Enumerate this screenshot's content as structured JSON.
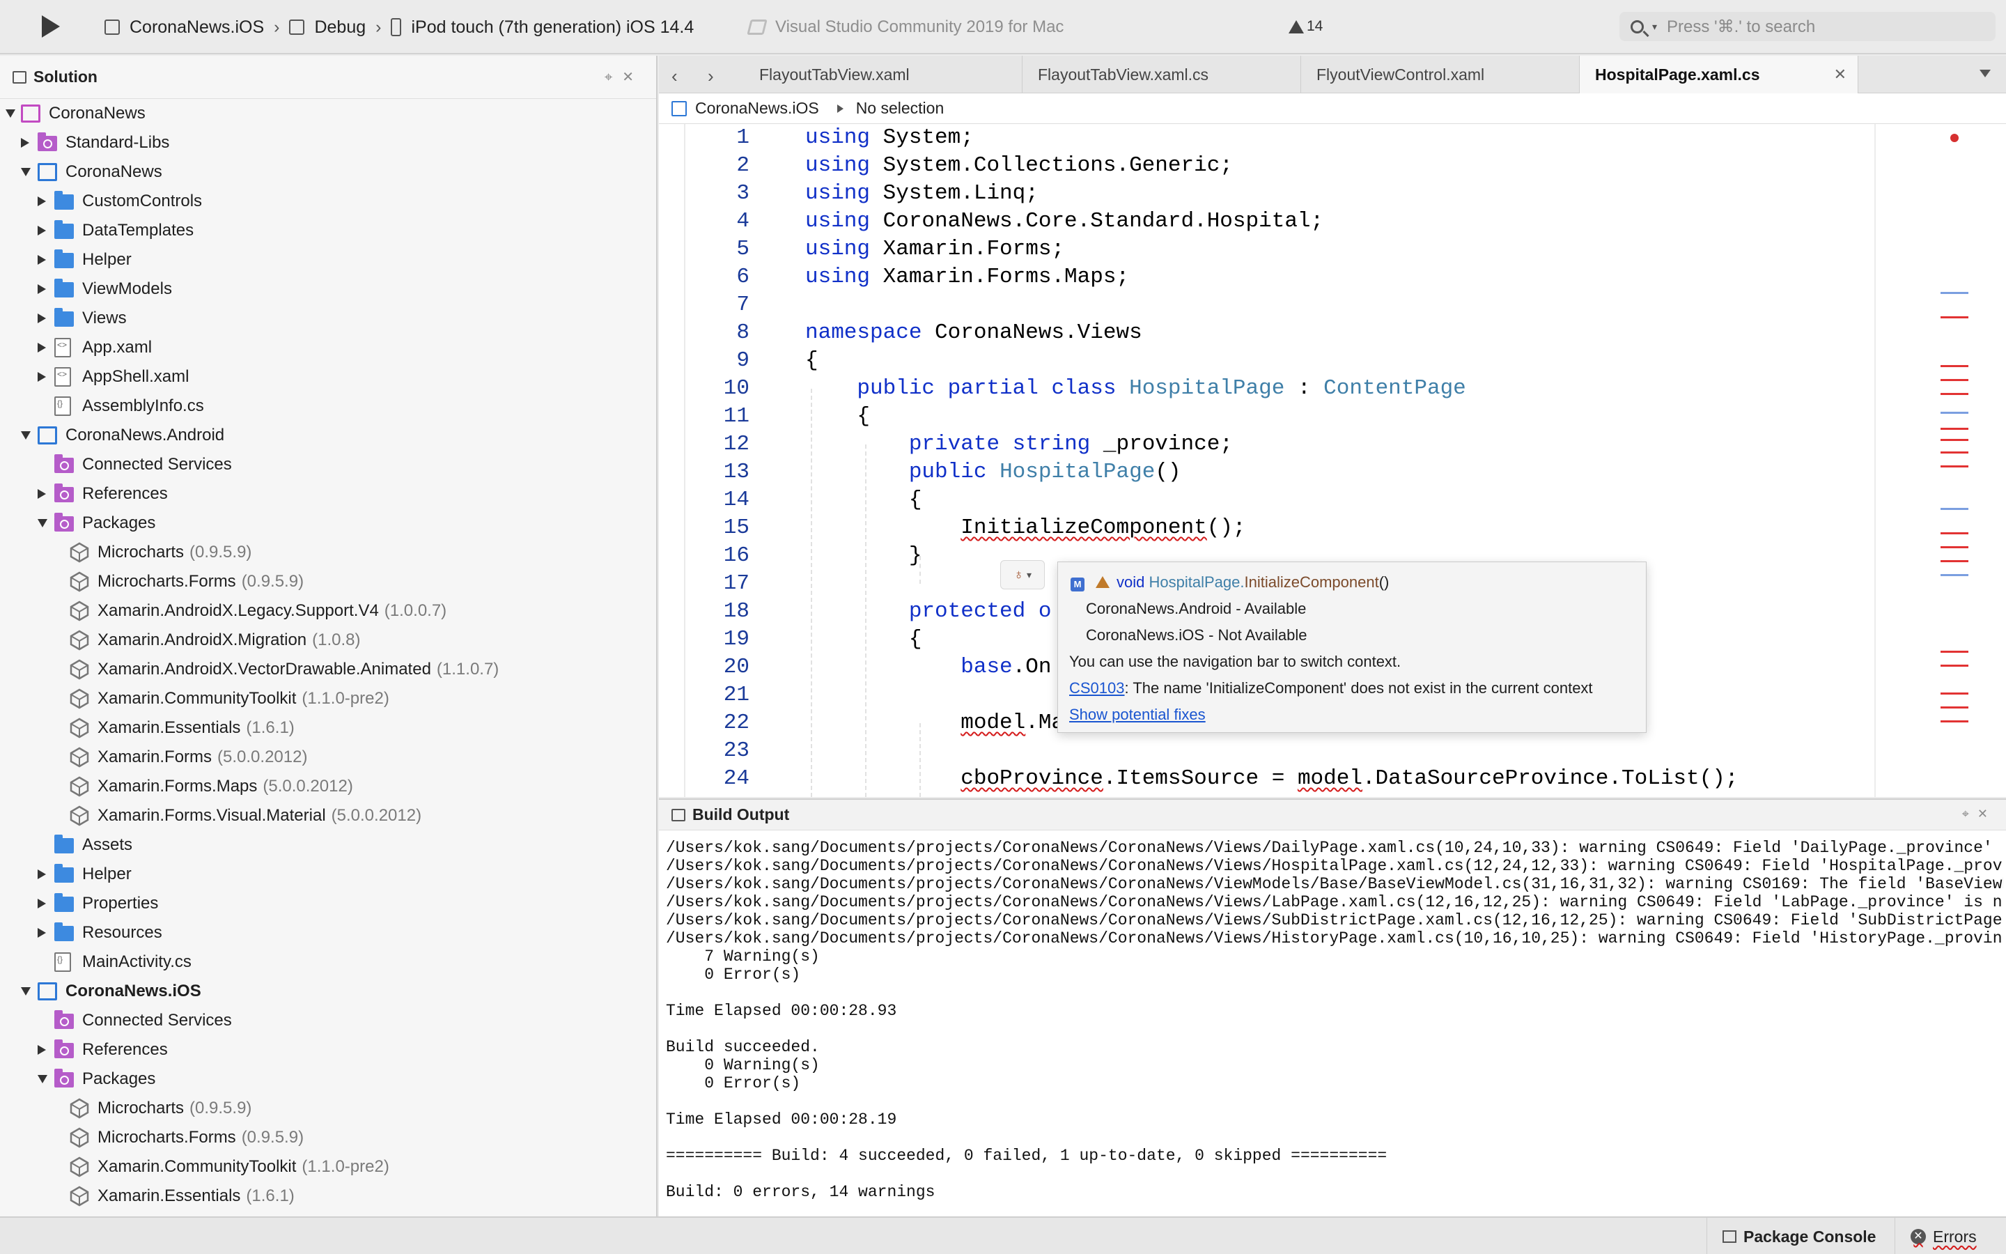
{
  "toolbar": {
    "scheme": "CoronaNews.iOS",
    "config": "Debug",
    "device": "iPod touch (7th generation) iOS 14.4",
    "app_title": "Visual Studio Community 2019 for Mac",
    "warning_count": "14",
    "search_placeholder": "Press '⌘.' to search"
  },
  "solution_pad": {
    "title": "Solution",
    "items": [
      {
        "label": "CoronaNews",
        "ver": "",
        "icon": "solution-icon",
        "depth": 0,
        "arrow": "down",
        "bold": false
      },
      {
        "label": "Standard-Libs",
        "ver": "",
        "icon": "folder-purple-icon",
        "depth": 1,
        "arrow": "right",
        "bold": false
      },
      {
        "label": "CoronaNews",
        "ver": "",
        "icon": "project-icon",
        "depth": 1,
        "arrow": "down",
        "bold": false
      },
      {
        "label": "CustomControls",
        "ver": "",
        "icon": "folder-icon",
        "depth": 2,
        "arrow": "right",
        "bold": false
      },
      {
        "label": "DataTemplates",
        "ver": "",
        "icon": "folder-icon",
        "depth": 2,
        "arrow": "right",
        "bold": false
      },
      {
        "label": "Helper",
        "ver": "",
        "icon": "folder-icon",
        "depth": 2,
        "arrow": "right",
        "bold": false
      },
      {
        "label": "ViewModels",
        "ver": "",
        "icon": "folder-icon",
        "depth": 2,
        "arrow": "right",
        "bold": false
      },
      {
        "label": "Views",
        "ver": "",
        "icon": "folder-icon",
        "depth": 2,
        "arrow": "right",
        "bold": false
      },
      {
        "label": "App.xaml",
        "ver": "",
        "icon": "xaml-file-icon",
        "depth": 2,
        "arrow": "right",
        "bold": false
      },
      {
        "label": "AppShell.xaml",
        "ver": "",
        "icon": "xaml-file-icon",
        "depth": 2,
        "arrow": "right",
        "bold": false
      },
      {
        "label": "AssemblyInfo.cs",
        "ver": "",
        "icon": "cs-file-icon",
        "depth": 2,
        "arrow": "",
        "bold": false
      },
      {
        "label": "CoronaNews.Android",
        "ver": "",
        "icon": "project-icon",
        "depth": 1,
        "arrow": "down",
        "bold": false
      },
      {
        "label": "Connected Services",
        "ver": "",
        "icon": "connected-services-icon",
        "depth": 2,
        "arrow": "",
        "bold": false
      },
      {
        "label": "References",
        "ver": "",
        "icon": "references-icon",
        "depth": 2,
        "arrow": "right",
        "bold": false
      },
      {
        "label": "Packages",
        "ver": "",
        "icon": "packages-icon",
        "depth": 2,
        "arrow": "down",
        "bold": false
      },
      {
        "label": "Microcharts",
        "ver": "(0.9.5.9)",
        "icon": "package-icon",
        "depth": 3,
        "arrow": "",
        "bold": false
      },
      {
        "label": "Microcharts.Forms",
        "ver": "(0.9.5.9)",
        "icon": "package-icon",
        "depth": 3,
        "arrow": "",
        "bold": false
      },
      {
        "label": "Xamarin.AndroidX.Legacy.Support.V4",
        "ver": "(1.0.0.7)",
        "icon": "package-icon",
        "depth": 3,
        "arrow": "",
        "bold": false
      },
      {
        "label": "Xamarin.AndroidX.Migration",
        "ver": "(1.0.8)",
        "icon": "package-icon",
        "depth": 3,
        "arrow": "",
        "bold": false
      },
      {
        "label": "Xamarin.AndroidX.VectorDrawable.Animated",
        "ver": "(1.1.0.7)",
        "icon": "package-icon",
        "depth": 3,
        "arrow": "",
        "bold": false
      },
      {
        "label": "Xamarin.CommunityToolkit",
        "ver": "(1.1.0-pre2)",
        "icon": "package-icon",
        "depth": 3,
        "arrow": "",
        "bold": false
      },
      {
        "label": "Xamarin.Essentials",
        "ver": "(1.6.1)",
        "icon": "package-icon",
        "depth": 3,
        "arrow": "",
        "bold": false
      },
      {
        "label": "Xamarin.Forms",
        "ver": "(5.0.0.2012)",
        "icon": "package-icon",
        "depth": 3,
        "arrow": "",
        "bold": false
      },
      {
        "label": "Xamarin.Forms.Maps",
        "ver": "(5.0.0.2012)",
        "icon": "package-icon",
        "depth": 3,
        "arrow": "",
        "bold": false
      },
      {
        "label": "Xamarin.Forms.Visual.Material",
        "ver": "(5.0.0.2012)",
        "icon": "package-icon",
        "depth": 3,
        "arrow": "",
        "bold": false
      },
      {
        "label": "Assets",
        "ver": "",
        "icon": "folder-icon",
        "depth": 2,
        "arrow": "",
        "bold": false
      },
      {
        "label": "Helper",
        "ver": "",
        "icon": "folder-icon",
        "depth": 2,
        "arrow": "right",
        "bold": false
      },
      {
        "label": "Properties",
        "ver": "",
        "icon": "folder-icon",
        "depth": 2,
        "arrow": "right",
        "bold": false
      },
      {
        "label": "Resources",
        "ver": "",
        "icon": "folder-icon",
        "depth": 2,
        "arrow": "right",
        "bold": false
      },
      {
        "label": "MainActivity.cs",
        "ver": "",
        "icon": "cs-file-icon",
        "depth": 2,
        "arrow": "",
        "bold": false
      },
      {
        "label": "CoronaNews.iOS",
        "ver": "",
        "icon": "project-icon",
        "depth": 1,
        "arrow": "down",
        "bold": true
      },
      {
        "label": "Connected Services",
        "ver": "",
        "icon": "connected-services-icon",
        "depth": 2,
        "arrow": "",
        "bold": false
      },
      {
        "label": "References",
        "ver": "",
        "icon": "references-icon",
        "depth": 2,
        "arrow": "right",
        "bold": false
      },
      {
        "label": "Packages",
        "ver": "",
        "icon": "packages-icon",
        "depth": 2,
        "arrow": "down",
        "bold": false
      },
      {
        "label": "Microcharts",
        "ver": "(0.9.5.9)",
        "icon": "package-icon",
        "depth": 3,
        "arrow": "",
        "bold": false
      },
      {
        "label": "Microcharts.Forms",
        "ver": "(0.9.5.9)",
        "icon": "package-icon",
        "depth": 3,
        "arrow": "",
        "bold": false
      },
      {
        "label": "Xamarin.CommunityToolkit",
        "ver": "(1.1.0-pre2)",
        "icon": "package-icon",
        "depth": 3,
        "arrow": "",
        "bold": false
      },
      {
        "label": "Xamarin.Essentials",
        "ver": "(1.6.1)",
        "icon": "package-icon",
        "depth": 3,
        "arrow": "",
        "bold": false
      }
    ]
  },
  "tabs": [
    {
      "label": "FlayoutTabView.xaml",
      "active": false
    },
    {
      "label": "FlayoutTabView.xaml.cs",
      "active": false
    },
    {
      "label": "FlyoutViewControl.xaml",
      "active": false
    },
    {
      "label": "HospitalPage.xaml.cs",
      "active": true
    }
  ],
  "pathbar": {
    "project": "CoronaNews.iOS",
    "selection": "No selection"
  },
  "code_lines": [
    {
      "n": "1",
      "html": "<span class=\"kw\">using</span> System;"
    },
    {
      "n": "2",
      "html": "<span class=\"kw\">using</span> System.Collections.Generic;"
    },
    {
      "n": "3",
      "html": "<span class=\"kw\">using</span> System.Linq;"
    },
    {
      "n": "4",
      "html": "<span class=\"kw\">using</span> CoronaNews.Core.Standard.Hospital;"
    },
    {
      "n": "5",
      "html": "<span class=\"kw\">using</span> Xamarin.Forms;"
    },
    {
      "n": "6",
      "html": "<span class=\"kw\">using</span> Xamarin.Forms.Maps;"
    },
    {
      "n": "7",
      "html": ""
    },
    {
      "n": "8",
      "html": "<span class=\"kw\">namespace</span> CoronaNews.Views"
    },
    {
      "n": "9",
      "html": "{"
    },
    {
      "n": "10",
      "html": "    <span class=\"kw\">public partial class</span> <span class=\"ty\">HospitalPage</span> : <span class=\"ty\">ContentPage</span>"
    },
    {
      "n": "11",
      "html": "    {"
    },
    {
      "n": "12",
      "html": "        <span class=\"kw\">private string</span> _province;"
    },
    {
      "n": "13",
      "html": "        <span class=\"kw\">public</span> <span class=\"ty\">HospitalPage</span>()"
    },
    {
      "n": "14",
      "html": "        {"
    },
    {
      "n": "15",
      "html": "            <span class=\"er\">InitializeComponent</span>();"
    },
    {
      "n": "16",
      "html": "        }"
    },
    {
      "n": "17",
      "html": ""
    },
    {
      "n": "18",
      "html": "        <span class=\"kw\">protected o</span>"
    },
    {
      "n": "19",
      "html": "        {"
    },
    {
      "n": "20",
      "html": "            <span class=\"kw\">base</span>.On"
    },
    {
      "n": "21",
      "html": ""
    },
    {
      "n": "22",
      "html": "            <span class=\"er\">model</span>.Ma"
    },
    {
      "n": "23",
      "html": ""
    },
    {
      "n": "24",
      "html": "            <span class=\"er\">cboProvince</span>.ItemsSource = <span class=\"er\">model</span>.DataSourceProvince.ToList();"
    }
  ],
  "tooltip": {
    "badge": "M",
    "signature_kw": "void",
    "signature_type": "HospitalPage",
    "signature_dot": ".",
    "signature_method": "InitializeComponent",
    "signature_parens": "()",
    "ctx1": "CoronaNews.Android - Available",
    "ctx2": "CoronaNews.iOS - Not Available",
    "hint": "You can use the navigation bar to switch context.",
    "error_code": "CS0103",
    "error_msg": ": The name 'InitializeComponent' does not exist in the current context",
    "fix_link": "Show potential fixes"
  },
  "build_output": {
    "title": "Build Output",
    "lines": [
      "/Users/kok.sang/Documents/projects/CoronaNews/CoronaNews/Views/DailyPage.xaml.cs(10,24,10,33): warning CS0649: Field 'DailyPage._province' is neve",
      "/Users/kok.sang/Documents/projects/CoronaNews/CoronaNews/Views/HospitalPage.xaml.cs(12,24,12,33): warning CS0649: Field 'HospitalPage._province' ",
      "/Users/kok.sang/Documents/projects/CoronaNews/CoronaNews/ViewModels/Base/BaseViewModel.cs(31,16,31,32): warning CS0169: The field 'BaseViewModel.",
      "/Users/kok.sang/Documents/projects/CoronaNews/CoronaNews/Views/LabPage.xaml.cs(12,16,12,25): warning CS0649: Field 'LabPage._province' is never a",
      "/Users/kok.sang/Documents/projects/CoronaNews/CoronaNews/Views/SubDistrictPage.xaml.cs(12,16,12,25): warning CS0649: Field 'SubDistrictPage._provi",
      "/Users/kok.sang/Documents/projects/CoronaNews/CoronaNews/Views/HistoryPage.xaml.cs(10,16,10,25): warning CS0649: Field 'HistoryPage._province' is ",
      "    7 Warning(s)",
      "    0 Error(s)",
      "",
      "Time Elapsed 00:00:28.93",
      "",
      "Build succeeded.",
      "    0 Warning(s)",
      "    0 Error(s)",
      "",
      "Time Elapsed 00:00:28.19",
      "",
      "========== Build: 4 succeeded, 0 failed, 1 up-to-date, 0 skipped ==========",
      "",
      "Build: 0 errors, 14 warnings"
    ]
  },
  "statusbar": {
    "package_console": "Package Console",
    "errors": "Errors"
  },
  "colors": {
    "keyword": "#1030c8",
    "type": "#3f7fa8",
    "error_underline": "#d41b1b",
    "folder": "#3d8ae0",
    "solution": "#c24bc2"
  }
}
